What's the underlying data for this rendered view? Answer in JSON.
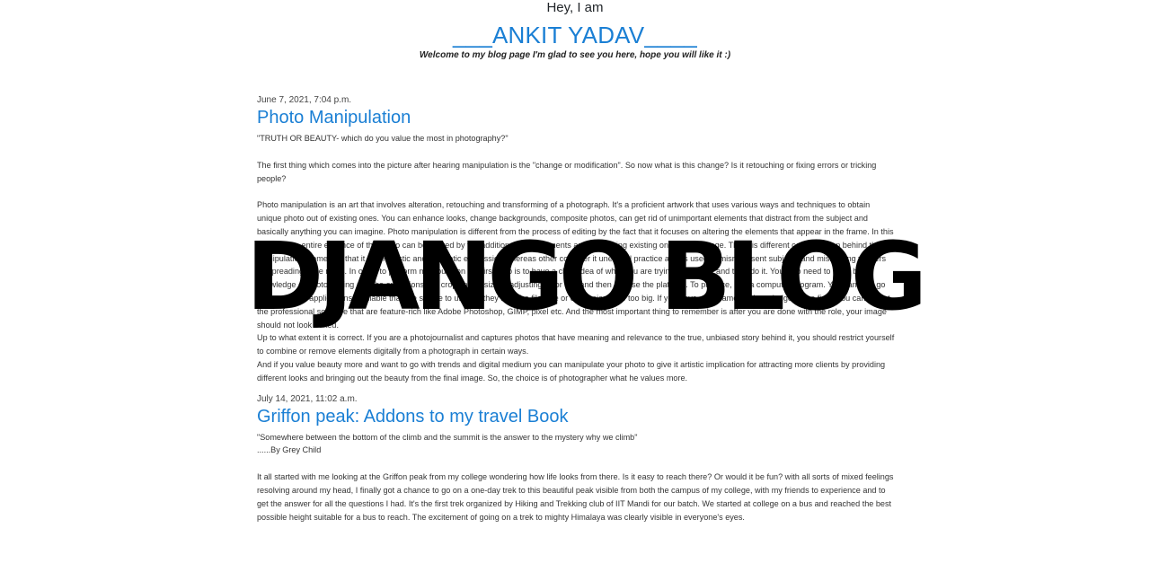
{
  "header": {
    "greeting": "Hey, I am",
    "name": "___ANKIT YADAV____",
    "tagline": "Welcome to my blog page I'm glad to see you here, hope you will like it :)"
  },
  "overlay": {
    "title": "DJANGO BLOG"
  },
  "posts": [
    {
      "date": "June 7, 2021, 7:04 p.m.",
      "title": "Photo Manipulation",
      "paragraphs": [
        "\"TRUTH OR BEAUTY- which do you value the most in photography?\"",
        "The first thing which comes into the picture after hearing manipulation is the \"change or modification\". So now what is this change? Is it retouching or fixing errors or tricking people?",
        "Photo manipulation is an art that involves alteration, retouching and transforming of a photograph. It's a proficient artwork that uses various ways and techniques to obtain unique photo out of existing ones. You can enhance looks, change backgrounds, composite photos, can get rid of unimportant elements that distract from the subject and basically anything you can imagine. Photo manipulation is different from the process of editing by the fact that it focuses on altering the elements that appear in the frame. In this process the entire essence of the photo can be altered by the addition of new elements and enhancing existing ones in the image. There is different consideration behind the manipulation, some say that it is an artistic and aesthetic expression whereas other consider it unethical practice as it is used to misrepresent subjects and misleading viewers by spreading false news. In order to perform manipulation the first step is to have a clear idea of what you are trying to achieve and then do it. You also need to have basic knowledge of photo editing and the operations like cropping, resizing, adjusting color etc. and then choose the platform. To practice, use a computer program. You can also go for free online applications available that are simple to use but they limit the file size or dimensions are too big. If you have a fundamental knowledge of the field, you can aim at the professional software that are feature-rich like Adobe Photoshop, GIMP, pixel etc. And the most important thing to remember is after you are done with the role, your image should not look edited.",
        "Up to what extent it is correct. If you are a photojournalist and captures photos that have meaning and relevance to the true, unbiased story behind it, you should restrict yourself to combine or remove elements digitally from a photograph in certain ways.",
        "And if you value beauty more and want to go with trends and digital medium you can manipulate your photo to give it artistic implication for attracting more clients by providing different looks and bringing out the beauty from the final image. So, the choice is of photographer what he values more."
      ]
    },
    {
      "date": "July 14, 2021, 11:02 a.m.",
      "title": "Griffon peak: Addons to my travel Book",
      "paragraphs": [
        "\"Somewhere between the bottom of the climb and the summit is the answer to the mystery why we climb\"",
        "......By Grey Child",
        "It all started with me looking at the Griffon peak from my college wondering how life looks from there. Is it easy to reach there? Or would it be fun? with all sorts of mixed feelings resolving around my head, I finally got a chance to go on a one-day trek to this beautiful peak visible from both the campus of my college, with my friends to experience and to get the answer for all the questions I had. It's the first trek organized by Hiking and Trekking club of IIT Mandi for our batch. We started at college on a bus and reached the best possible height suitable for a bus to reach. The excitement of going on a trek to mighty Himalaya was clearly visible in everyone's eyes."
      ]
    }
  ]
}
